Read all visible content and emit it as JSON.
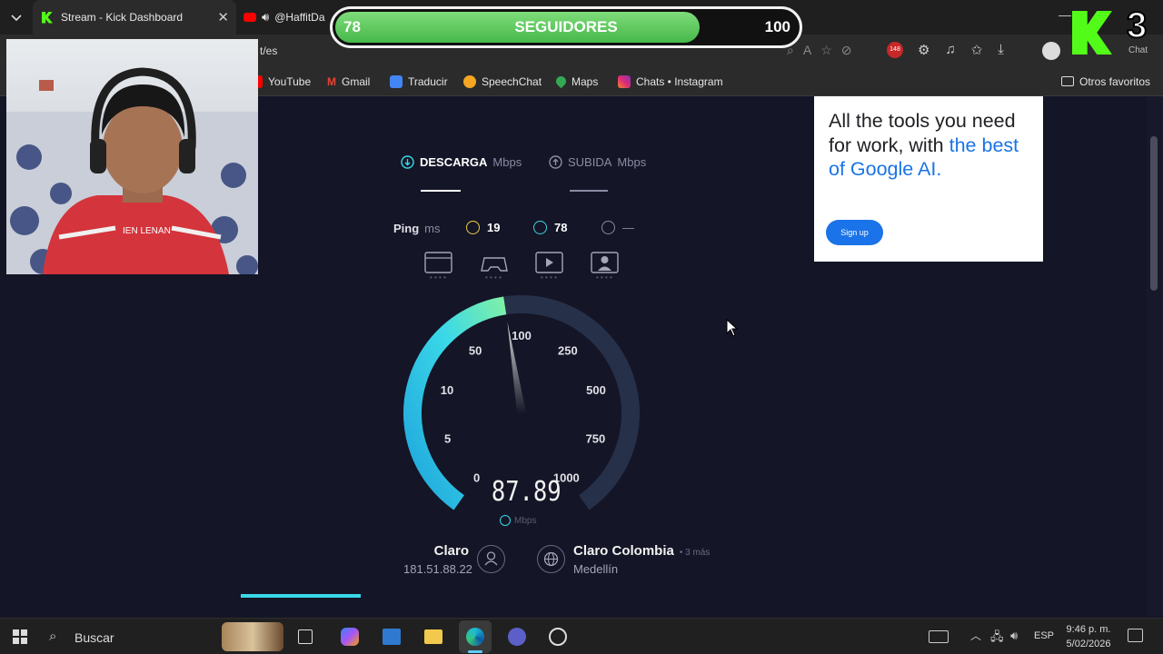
{
  "browser": {
    "tabs": [
      {
        "label": "Stream - Kick Dashboard",
        "icon": "kick-icon"
      },
      {
        "label": "@HaffitDa",
        "icon": "youtube-icon"
      }
    ],
    "address_suffix": "t/es",
    "bookmarks": [
      {
        "label": "YouTube",
        "icon": "youtube-icon",
        "color": "#ff0000"
      },
      {
        "label": "Gmail",
        "icon": "gmail-icon",
        "color": "#ea4335"
      },
      {
        "label": "Traducir",
        "icon": "translate-icon",
        "color": "#4285f4"
      },
      {
        "label": "SpeechChat",
        "icon": "speechchat-icon",
        "color": "#f5a623"
      },
      {
        "label": "Maps",
        "icon": "maps-icon",
        "color": "#34a853"
      },
      {
        "label": "Chats • Instagram",
        "icon": "instagram-icon",
        "color": "#d6249f"
      }
    ],
    "other_favorites": "Otros favoritos",
    "chat_label": "Chat",
    "extension_badge": "148"
  },
  "overlay": {
    "followers_current": "78",
    "followers_label": "SEGUIDORES",
    "followers_goal": "100",
    "followers_progress": 0.78,
    "kick_count": "3"
  },
  "speedtest": {
    "download_label": "DESCARGA",
    "download_unit": "Mbps",
    "upload_label": "SUBIDA",
    "upload_unit": "Mbps",
    "ping_label": "Ping",
    "ping_unit": "ms",
    "ping_idle": "19",
    "ping_download": "78",
    "ping_upload": "—",
    "speed_value": "87.89",
    "speed_unit": "Mbps",
    "gauge_ticks": [
      "0",
      "5",
      "10",
      "50",
      "100",
      "250",
      "500",
      "750",
      "1000"
    ],
    "isp_name": "Claro",
    "isp_ip": "181.51.88.22",
    "server_name": "Claro Colombia",
    "server_more": "• 3 más",
    "server_city": "Medellín",
    "accent_color": "#3ad8e8"
  },
  "ad": {
    "line1": "All the tools you need for work, with ",
    "highlight": "the best of Google AI.",
    "button": "Sign up"
  },
  "taskbar": {
    "search_placeholder": "Buscar",
    "language": "ESP",
    "time": "9:46 p. m.",
    "date": "5/02/2026"
  }
}
